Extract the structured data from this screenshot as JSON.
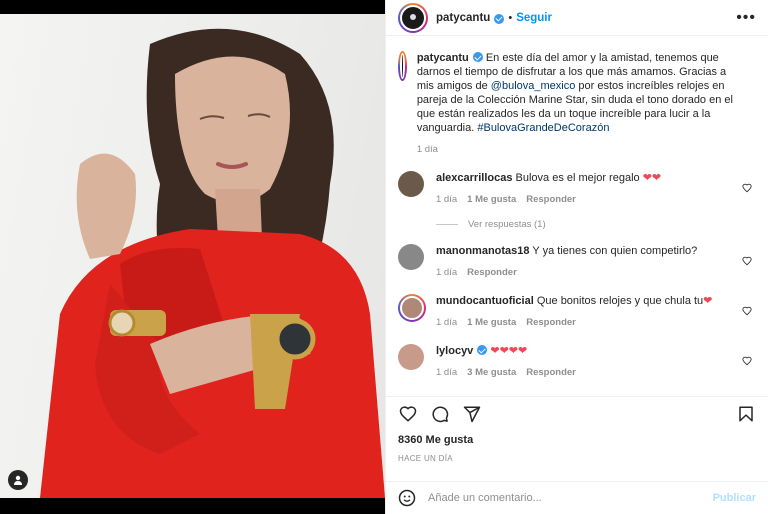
{
  "header": {
    "username": "patycantu",
    "follow_label": "Seguir",
    "dot": "•",
    "more": "•••"
  },
  "caption": {
    "username": "patycantu",
    "text_before": "En este día del amor y la amistad, tenemos que darnos el tiempo de disfrutar a los que más amamos. Gracias a mis amigos de ",
    "mention": "@bulova_mexico",
    "text_after": " por estos increíbles relojes en pareja de la Colección Marine Star, sin duda el tono dorado en el que están realizados les da un toque increíble para lucir a la vanguardia. ",
    "hashtag": "#BulovaGrandeDeCorazón",
    "time": "1 día"
  },
  "comments": [
    {
      "username": "alexcarrillocas",
      "text": "Bulova es el mejor regalo",
      "hearts": "❤❤",
      "time": "1 día",
      "likes": "1 Me gusta",
      "reply": "Responder",
      "avatar_color": "#6b5a4a"
    },
    {
      "username": "manonmanotas18",
      "text": "Y ya tienes con quien competirlo?",
      "hearts": "",
      "time": "1 día",
      "likes": "",
      "reply": "Responder",
      "avatar_color": "#888888"
    },
    {
      "username": "mundocantuoficial",
      "text": "Que bonitos relojes y que chula tu",
      "hearts": "❤",
      "time": "1 día",
      "likes": "1 Me gusta",
      "reply": "Responder",
      "avatar_color": "#b08878"
    },
    {
      "username": "lylocyv",
      "text": "",
      "hearts": "❤❤❤❤",
      "time": "1 día",
      "likes": "3 Me gusta",
      "reply": "Responder",
      "avatar_color": "#c89a8a"
    }
  ],
  "view_replies": "Ver respuestas (1)",
  "likes_count": "8360 Me gusta",
  "posted_time": "HACE UN DÍA",
  "add_comment": {
    "placeholder": "Añade un comentario...",
    "post_label": "Publicar"
  },
  "colors": {
    "accent": "#0095f6",
    "heart": "#ed4956",
    "muted": "#8e8e8e",
    "dress": "#e0231d"
  }
}
